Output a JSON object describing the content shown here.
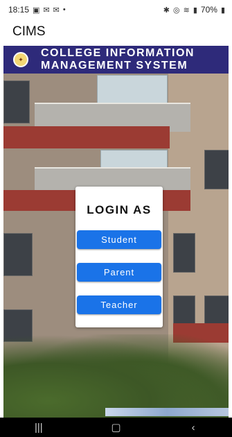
{
  "status": {
    "time": "18:15",
    "left_icons": [
      "image-icon",
      "mail-icon",
      "mail-icon",
      "dot-icon"
    ],
    "right_icons": [
      "bluetooth-icon",
      "hotspot-icon",
      "wifi-icon",
      "signal-icon"
    ],
    "battery": "70%"
  },
  "app": {
    "title": "CIMS"
  },
  "banner": {
    "line1": "COLLEGE INFORMATION",
    "line2": "MANAGEMENT SYSTEM",
    "accent": "#2e2a7a"
  },
  "login": {
    "heading": "LOGIN AS",
    "buttons": [
      {
        "label": "Student"
      },
      {
        "label": "Parent"
      },
      {
        "label": "Teacher"
      }
    ],
    "button_color": "#1a73e8"
  },
  "nav": {
    "recents_icon": "recents-icon",
    "home_icon": "home-icon",
    "back_icon": "back-icon"
  }
}
